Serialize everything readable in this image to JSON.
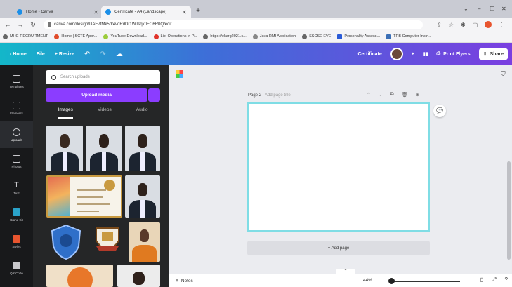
{
  "browser": {
    "tabs": [
      {
        "title": "Home - Canva",
        "active": false
      },
      {
        "title": "Certificate - A4 (Landscape)",
        "active": true
      }
    ],
    "url": "canva.com/design/DAE7tMk5d/4vqRdDr1WTsqk0EC6R0Q/edit",
    "bookmarks": [
      "MHC-RECRUITMENT",
      "Home | SCTE Appr...",
      "YouTube Download...",
      "List Operations in P...",
      "https://ekarg2021.c...",
      "Java RMI Application",
      "SSCSE EVE",
      "Personality Assess...",
      "TRB Computer Instr..."
    ]
  },
  "topbar": {
    "home": "Home",
    "file": "File",
    "resize": "Resize",
    "doc_title": "Certificate",
    "print": "Print Flyers",
    "share": "Share"
  },
  "rail": [
    {
      "label": "Templates",
      "icon": "templates-icon"
    },
    {
      "label": "Elements",
      "icon": "elements-icon"
    },
    {
      "label": "Uploads",
      "icon": "uploads-icon",
      "active": true
    },
    {
      "label": "Photos",
      "icon": "photos-icon"
    },
    {
      "label": "Text",
      "icon": "text-icon"
    },
    {
      "label": "Brand Kit",
      "icon": "brandkit-icon"
    },
    {
      "label": "Styles",
      "icon": "styles-icon"
    },
    {
      "label": "QR Code",
      "icon": "qrcode-icon"
    }
  ],
  "panel": {
    "search_placeholder": "Search uploads",
    "upload_button": "Upload media",
    "tabs": [
      "Images",
      "Videos",
      "Audio"
    ],
    "active_tab": "Images"
  },
  "editor": {
    "page_label": "Page 2",
    "page_title_placeholder": "Add page title",
    "add_page": "+ Add page"
  },
  "bottom": {
    "notes": "Notes",
    "zoom": "44%"
  },
  "colors": {
    "accent": "#8b3dff",
    "page_border": "#7fdde5",
    "rail_bg": "#18191b",
    "panel_bg": "#252627"
  }
}
